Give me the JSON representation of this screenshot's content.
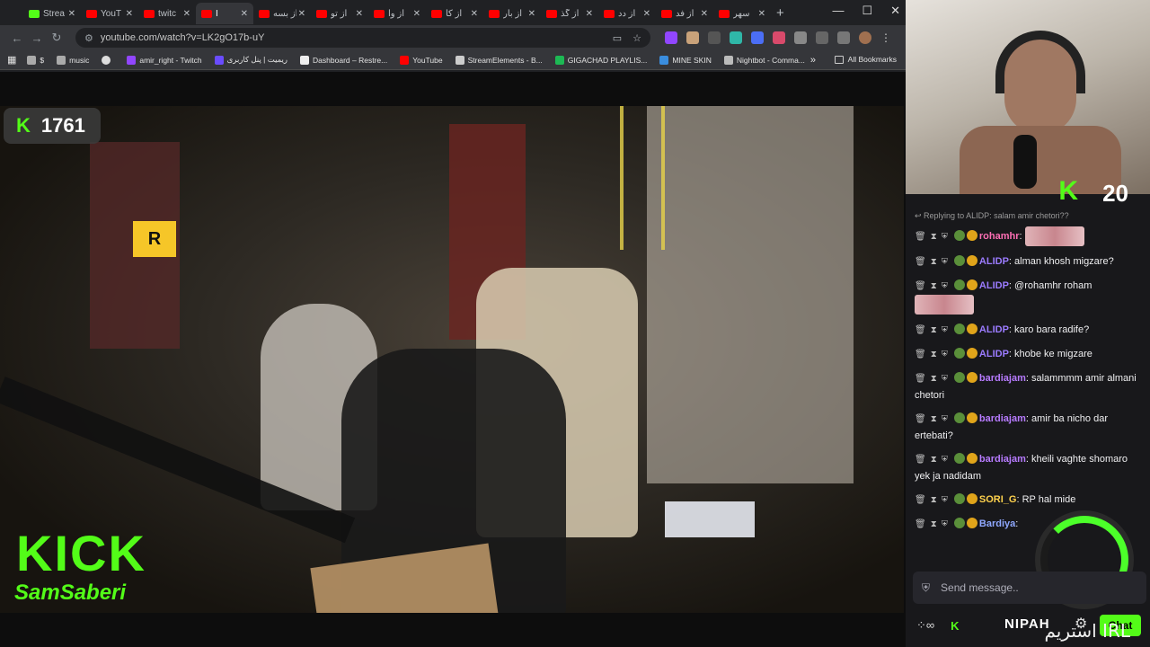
{
  "browser": {
    "tabs": [
      {
        "label": "Strea",
        "favicon": "kick"
      },
      {
        "label": "YouT",
        "favicon": "youtube"
      },
      {
        "label": "twitc",
        "favicon": "youtube"
      },
      {
        "label": "I",
        "favicon": "youtube",
        "active": true
      },
      {
        "label": "از بسه",
        "favicon": "youtube"
      },
      {
        "label": "از تو",
        "favicon": "youtube"
      },
      {
        "label": "از وا",
        "favicon": "youtube"
      },
      {
        "label": "از کا",
        "favicon": "youtube"
      },
      {
        "label": "از بار",
        "favicon": "youtube"
      },
      {
        "label": "از گذ",
        "favicon": "youtube"
      },
      {
        "label": "از دد",
        "favicon": "youtube"
      },
      {
        "label": "از فد",
        "favicon": "youtube"
      },
      {
        "label": "سهر",
        "favicon": "youtube"
      }
    ],
    "new_tab": "+",
    "window_controls": {
      "minimize": "—",
      "maximize": "☐",
      "close": "✕"
    },
    "nav": {
      "back": "←",
      "forward": "→",
      "reload": "↻"
    },
    "url": "youtube.com/watch?v=LK2gO17b-uY",
    "bookmarks": [
      {
        "label": "$",
        "icon": "folder-icon"
      },
      {
        "label": "music",
        "icon": "folder-icon"
      },
      {
        "label": "",
        "icon": "globe-icon"
      },
      {
        "label": "amir_right - Twitch",
        "icon": "twitch-icon"
      },
      {
        "label": "ریمیت | پنل کاربری",
        "icon": "remit-icon"
      },
      {
        "label": "Dashboard – Restre...",
        "icon": "restream-icon"
      },
      {
        "label": "YouTube",
        "icon": "youtube-icon"
      },
      {
        "label": "StreamElements - B...",
        "icon": "streamelements-icon"
      },
      {
        "label": "GIGACHAD PLAYLIS...",
        "icon": "spotify-icon"
      },
      {
        "label": "MINE SKIN",
        "icon": "mineskin-icon"
      },
      {
        "label": "Nightbot - Comma...",
        "icon": "nightbot-icon"
      }
    ],
    "more_bookmarks": "»",
    "all_bookmarks": "All Bookmarks"
  },
  "video": {
    "viewer_count": "1761",
    "kick_logo": "KICK",
    "channel": "SamSaberi",
    "sign_letter": "R"
  },
  "side": {
    "cam_viewers": "20",
    "reply_context": "Replying to ALIDP: salam amir chetori??",
    "messages": [
      {
        "user": "rohamhr",
        "color": "#ff6fb5",
        "text": "",
        "emote": true
      },
      {
        "user": "ALIDP",
        "color": "#9b7bff",
        "text": "alman khosh migzare?"
      },
      {
        "user": "ALIDP",
        "color": "#9b7bff",
        "text": "@rohamhr roham",
        "emote": true
      },
      {
        "user": "ALIDP",
        "color": "#9b7bff",
        "text": "karo bara radife?"
      },
      {
        "user": "ALIDP",
        "color": "#9b7bff",
        "text": "khobe ke migzare"
      },
      {
        "user": "bardiajam",
        "color": "#b77bff",
        "text": "salammmm amir almani chetori"
      },
      {
        "user": "bardiajam",
        "color": "#b77bff",
        "text": "amir ba nicho dar ertebati?"
      },
      {
        "user": "bardiajam",
        "color": "#b77bff",
        "text": "kheili vaghte shomaro yek ja nadidam"
      },
      {
        "user": "SORI_G",
        "color": "#ffd24d",
        "text": "RP hal mide"
      },
      {
        "user": "Bardiya",
        "color": "#8fa8ff",
        "text": ""
      }
    ],
    "composer_placeholder": "Send message..",
    "chat_button": "Chat",
    "footer_brand": "NIPAH",
    "overlay_text": "استریم IRL",
    "progress": 0.72
  }
}
